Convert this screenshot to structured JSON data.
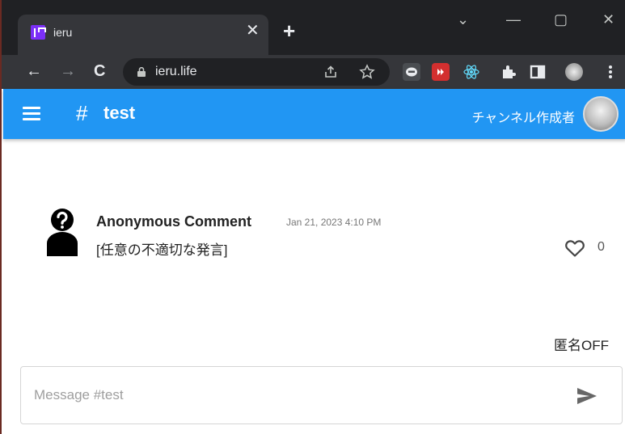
{
  "browser": {
    "tab_title": "ieru",
    "tab_close": "✕",
    "new_tab": "+",
    "url": "ieru.life",
    "window_controls": {
      "dropdown": "⌄",
      "minimize": "—",
      "maximize": "▢",
      "close": "✕"
    },
    "nav": {
      "back": "←",
      "forward": "→",
      "reload": "C"
    },
    "icons": [
      "tab-favicon-icon",
      "lock-icon",
      "share-icon",
      "star-icon",
      "line-extension-icon",
      "youtube-extension-icon",
      "react-extension-icon",
      "puzzle-icon",
      "side-panel-icon",
      "profile-avatar-icon",
      "more-menu-icon"
    ]
  },
  "appbar": {
    "channel_hash": "#",
    "channel_name": "test",
    "creator_label": "チャンネル作成者",
    "accent_color": "#2196f3"
  },
  "messages": [
    {
      "author": "Anonymous Comment",
      "timestamp": "Jan 21, 2023 4:10 PM",
      "body": "[任意の不適切な発言]",
      "likes": "0"
    }
  ],
  "anon_toggle": "匿名OFF",
  "composer": {
    "placeholder": "Message #test"
  }
}
